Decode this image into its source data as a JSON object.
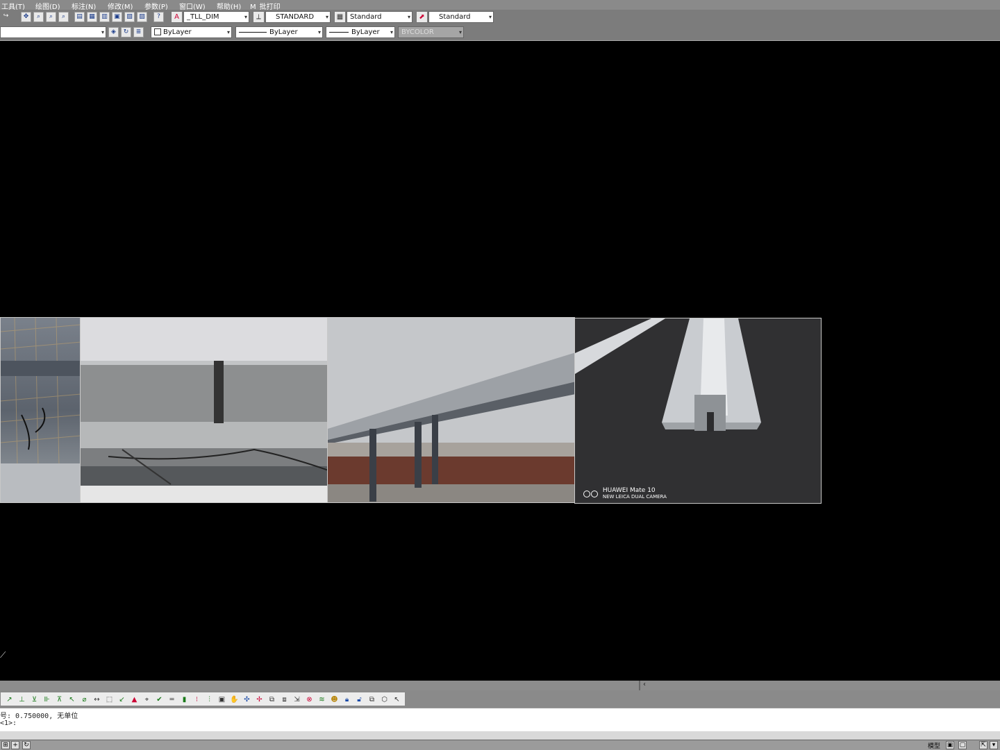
{
  "menu": [
    "工具(T)",
    "绘图(D)",
    "标注(N)",
    "修改(M)",
    "参数(P)",
    "窗口(W)",
    "帮助(H)",
    "M_批打印"
  ],
  "toolbar1": {
    "text_style": "_TLL_DIM",
    "dim_style": "STANDARD",
    "table_style": "Standard",
    "multileader_style": "Standard"
  },
  "toolbar2": {
    "layer": "ByLayer",
    "linetype": "ByLayer",
    "lineweight": "ByLayer",
    "plotstyle": "BYCOLOR"
  },
  "photos": {
    "watermark_brand": "HUAWEI Mate 10",
    "watermark_sub": "NEW LEICA DUAL CAMERA"
  },
  "command_line": {
    "line1": "号: 0.750000, 无单位",
    "line2": "<1>:"
  },
  "status": {
    "label": "模型"
  },
  "colors": {
    "canvas": "#000000",
    "toolbar_bg": "#7c7c7c",
    "menubar_bg": "#8a8a8a"
  }
}
